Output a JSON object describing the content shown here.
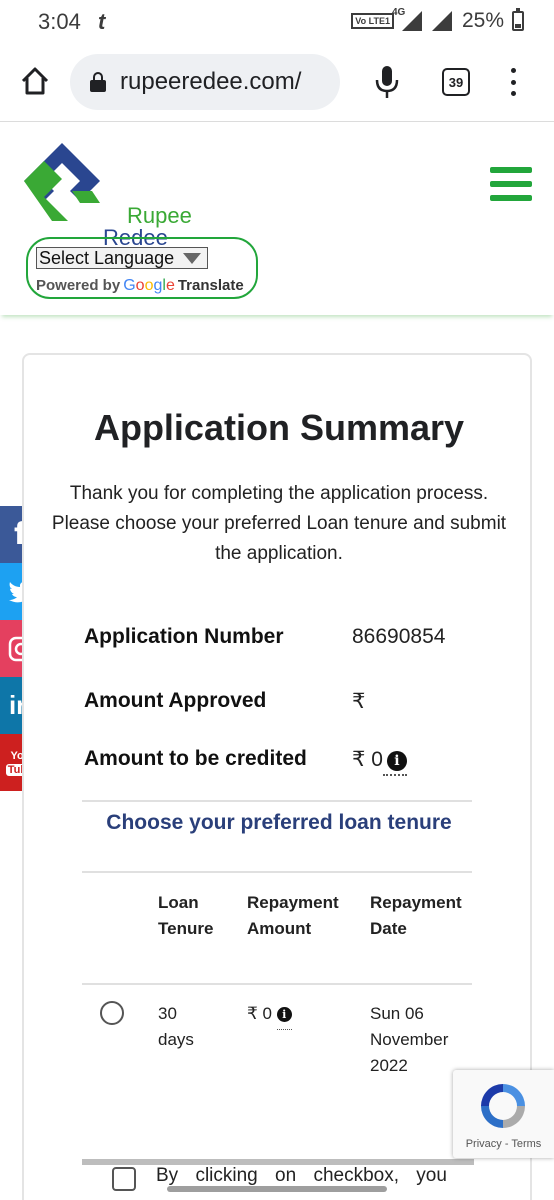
{
  "status_bar": {
    "time": "3:04",
    "carrier_glyph": "t",
    "volte": "Vo LTE1",
    "network": "4G",
    "battery": "25%"
  },
  "browser": {
    "url": "rupeeredee.com/",
    "tab_count": "39"
  },
  "header": {
    "logo_line1": "Rupee",
    "logo_line2": "Redee",
    "language_select": "Select Language",
    "powered_by": "Powered by",
    "google_letters": [
      "G",
      "o",
      "o",
      "g",
      "l",
      "e"
    ],
    "translate": "Translate"
  },
  "social": {
    "facebook": "f",
    "linkedin": "in",
    "youtube_line1": "You",
    "youtube_line2": "Tube"
  },
  "summary": {
    "title": "Application Summary",
    "intro": "Thank you for completing the application process. Please choose your preferred Loan tenure and submit the application.",
    "rows": [
      {
        "label": "Application Number",
        "value": "86690854"
      },
      {
        "label": "Amount Approved",
        "value": "₹"
      },
      {
        "label": "Amount to be credited",
        "value": "₹ 0"
      }
    ],
    "info_glyph": "i",
    "tenure_heading": "Choose your preferred loan tenure",
    "table": {
      "headers": [
        {
          "line1": "Loan",
          "line2": "Tenure"
        },
        {
          "line1": "Repayment",
          "line2": "Amount"
        },
        {
          "line1": "Repayment",
          "line2": "Date"
        }
      ],
      "rows": [
        {
          "tenure_line1": "30",
          "tenure_line2": "days",
          "amount": "₹ 0",
          "date_line1": "Sun 06",
          "date_line2": "November",
          "date_line3": "2022"
        }
      ]
    },
    "consent_text": "By clicking on checkbox, you"
  },
  "recaptcha": {
    "privacy": "Privacy",
    "separator": " - ",
    "terms": "Terms"
  },
  "colors": {
    "brand_green": "#22a63b",
    "brand_blue": "#2a4690",
    "heading_blue": "#2a3f7a"
  }
}
